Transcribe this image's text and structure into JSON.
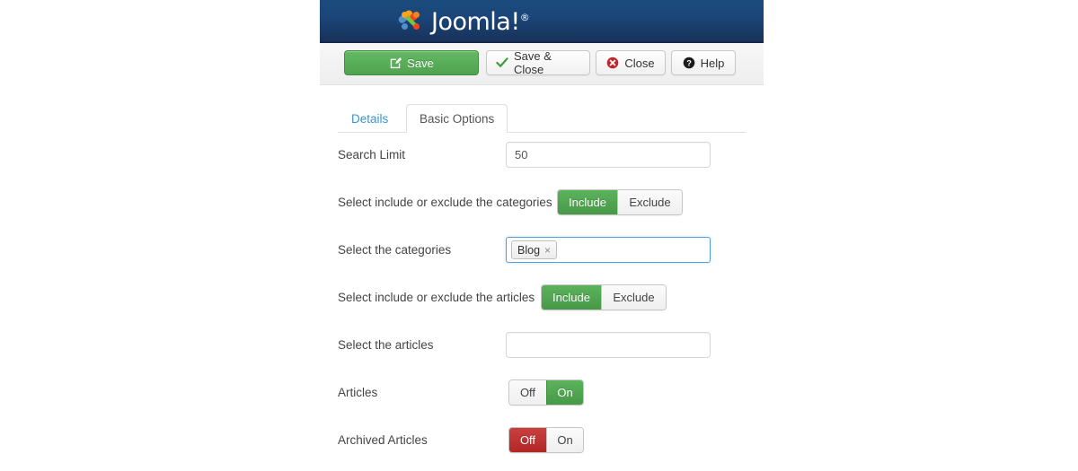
{
  "header": {
    "brand_name": "Joomla!",
    "trademark": "®",
    "logo_icon": "joomla-pinwheel-logo"
  },
  "toolbar": {
    "buttons": [
      {
        "label": "Save",
        "icon": "edit-square-icon",
        "style": "green"
      },
      {
        "label": "Save & Close",
        "icon": "check-icon",
        "style": "light"
      },
      {
        "label": "Close",
        "icon": "red-circle-x-icon",
        "style": "light"
      },
      {
        "label": "Help",
        "icon": "question-circle-icon",
        "style": "light"
      }
    ]
  },
  "tabs": [
    {
      "label": "Details",
      "active": false
    },
    {
      "label": "Basic Options",
      "active": true
    }
  ],
  "form": {
    "search_limit": {
      "label": "Search Limit",
      "value": "50",
      "placeholder": ""
    },
    "categories_mode": {
      "label": "Select include or exclude the categories",
      "options": [
        "Include",
        "Exclude"
      ],
      "selected": "Include"
    },
    "categories": {
      "label": "Select the categories",
      "chips": [
        {
          "label": "Blog",
          "remove_icon": "×"
        }
      ],
      "placeholder": ""
    },
    "articles_mode": {
      "label": "Select include or exclude the articles",
      "options": [
        "Include",
        "Exclude"
      ],
      "selected": "Include"
    },
    "articles_select": {
      "label": "Select the articles",
      "value": "",
      "placeholder": ""
    },
    "articles_toggle": {
      "label": "Articles",
      "options": [
        "Off",
        "On"
      ],
      "selected": "On"
    },
    "archived_articles_toggle": {
      "label": "Archived Articles",
      "options": [
        "Off",
        "On"
      ],
      "selected": "Off"
    }
  },
  "colors": {
    "header_blue": "#1a4679",
    "accent_green": "#4fa34f",
    "danger_red": "#b32626",
    "link_blue": "#3a95d6"
  }
}
